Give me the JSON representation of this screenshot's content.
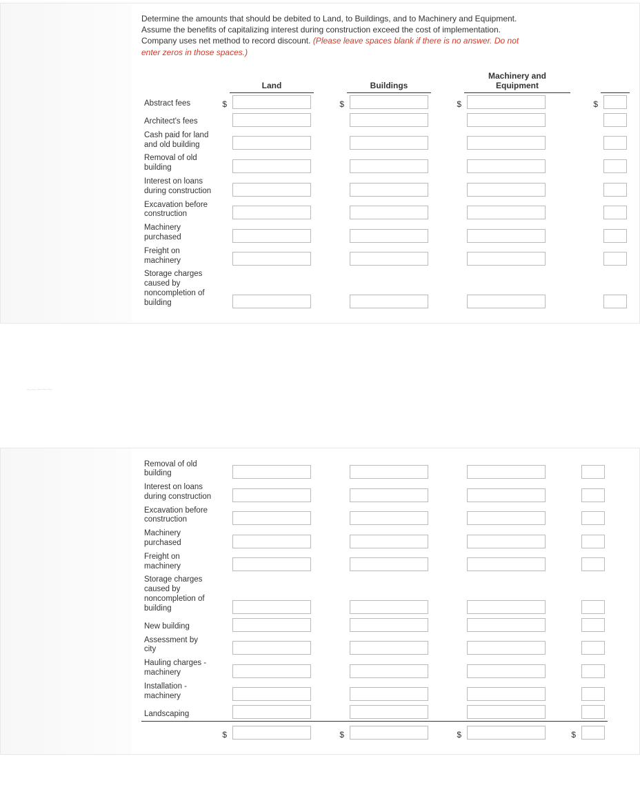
{
  "instruction_plain": "Determine the amounts that should be debited to Land, to Buildings, and to Machinery and Equipment. Assume the benefits of capitalizing interest during construction exceed the cost of implementation. Company uses net method to record discount. ",
  "instruction_em": "(Please leave spaces blank if there is no answer. Do not enter zeros in those spaces.)",
  "headers": {
    "land": "Land",
    "buildings": "Buildings",
    "mande": "Machinery and Equipment"
  },
  "panel1_rows": [
    {
      "label": "Abstract fees",
      "show_dollar": true
    },
    {
      "label": "Architect's fees"
    },
    {
      "label": "Cash paid for land and old building"
    },
    {
      "label": "Removal of old building"
    },
    {
      "label": "Interest on loans during construction"
    },
    {
      "label": "Excavation before construction"
    },
    {
      "label": "Machinery purchased"
    },
    {
      "label": "Freight on machinery"
    },
    {
      "label": "Storage charges caused by noncompletion of building"
    }
  ],
  "panel2_rows": [
    {
      "label": "Removal of old building"
    },
    {
      "label": "Interest on loans during construction"
    },
    {
      "label": "Excavation before construction"
    },
    {
      "label": "Machinery purchased"
    },
    {
      "label": "Freight on machinery"
    },
    {
      "label": "Storage charges caused by noncompletion of building"
    },
    {
      "label": "New building"
    },
    {
      "label": "Assessment by city"
    },
    {
      "label": "Hauling charges - machinery"
    },
    {
      "label": "Installation - machinery"
    },
    {
      "label": "Landscaping"
    }
  ],
  "dollar": "$"
}
